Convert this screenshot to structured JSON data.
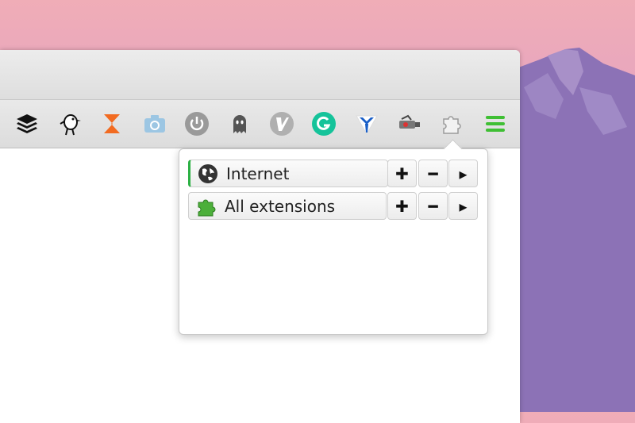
{
  "popup": {
    "rows": [
      {
        "label": "Internet",
        "active": true,
        "icon": "globe-icon"
      },
      {
        "label": "All extensions",
        "active": false,
        "icon": "puzzle-icon"
      }
    ],
    "buttons": {
      "plus": "✚",
      "minus": "━",
      "more": "▸"
    }
  },
  "toolbar": {
    "icons": [
      "buffer-icon",
      "bird-icon",
      "zotero-icon",
      "camera-icon",
      "power-icon",
      "ghost-icon",
      "vimium-icon",
      "grammarly-icon",
      "shield-icon",
      "spy-icon",
      "puzzle-icon",
      "menu-icon"
    ]
  },
  "colors": {
    "accent": "#2bb043",
    "menu": "#3fbf34"
  }
}
